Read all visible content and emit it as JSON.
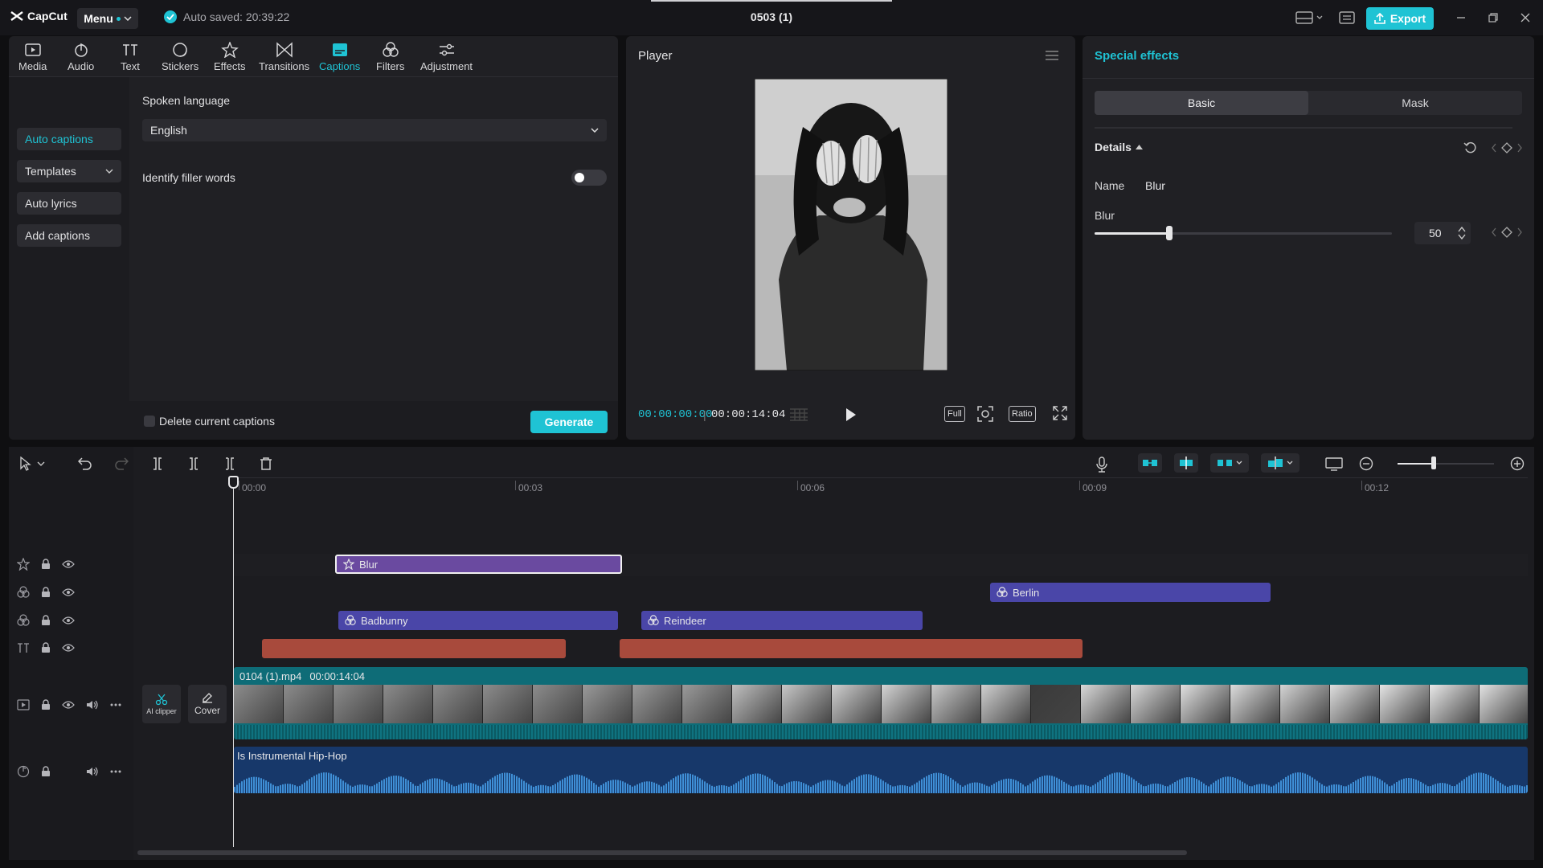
{
  "app": {
    "name": "CapCut",
    "menu_label": "Menu",
    "autosave_text": "Auto saved: 20:39:22",
    "project_title": "0503 (1)",
    "export_label": "Export"
  },
  "media_toolbar": [
    {
      "label": "Media",
      "icon": "media-icon",
      "active": false
    },
    {
      "label": "Audio",
      "icon": "audio-icon",
      "active": false
    },
    {
      "label": "Text",
      "icon": "text-icon",
      "active": false
    },
    {
      "label": "Stickers",
      "icon": "stickers-icon",
      "active": false
    },
    {
      "label": "Effects",
      "icon": "effects-icon",
      "active": false
    },
    {
      "label": "Transitions",
      "icon": "transitions-icon",
      "active": false
    },
    {
      "label": "Captions",
      "icon": "captions-icon",
      "active": true
    },
    {
      "label": "Filters",
      "icon": "filters-icon",
      "active": false
    },
    {
      "label": "Adjustment",
      "icon": "adjustment-icon",
      "active": false
    }
  ],
  "captions_nav": [
    {
      "label": "Auto captions",
      "active": true
    },
    {
      "label": "Templates",
      "active": false
    },
    {
      "label": "Auto lyrics",
      "active": false
    },
    {
      "label": "Add captions",
      "active": false
    }
  ],
  "captions": {
    "spoken_language_label": "Spoken language",
    "language_value": "English",
    "filler_label": "Identify filler words",
    "filler_enabled": false,
    "delete_label": "Delete current captions",
    "generate_label": "Generate"
  },
  "player": {
    "title": "Player",
    "current_time": "00:00:00:00",
    "total_time": "00:00:14:04",
    "full_label": "Full",
    "ratio_label": "Ratio"
  },
  "special_effects": {
    "title": "Special effects",
    "tabs": [
      {
        "label": "Basic",
        "active": true
      },
      {
        "label": "Mask",
        "active": false
      }
    ],
    "details_label": "Details",
    "name_label": "Name",
    "name_value": "Blur",
    "blur_label": "Blur",
    "blur_value": "50",
    "blur_level_percent": 50
  },
  "timeline": {
    "ruler": [
      "00:00",
      "00:03",
      "00:06",
      "00:09",
      "00:12"
    ],
    "effect_clip": "Blur",
    "filter_clips": [
      "Berlin",
      "Badbunny",
      "Reindeer"
    ],
    "video_clip_name": "0104 (1).mp4",
    "video_clip_duration": "00:00:14:04",
    "audio_clip_name": "Is Instrumental Hip-Hop",
    "ai_clipper_label": "AI clipper",
    "cover_label": "Cover"
  },
  "colors": {
    "accent": "#1fc3d4",
    "effect_clip": "#6a4aa0",
    "filter_clip": "#4a46a8",
    "text_clip": "#a84a3c",
    "video_track": "#0e6c77",
    "audio_track": "#17386a"
  }
}
